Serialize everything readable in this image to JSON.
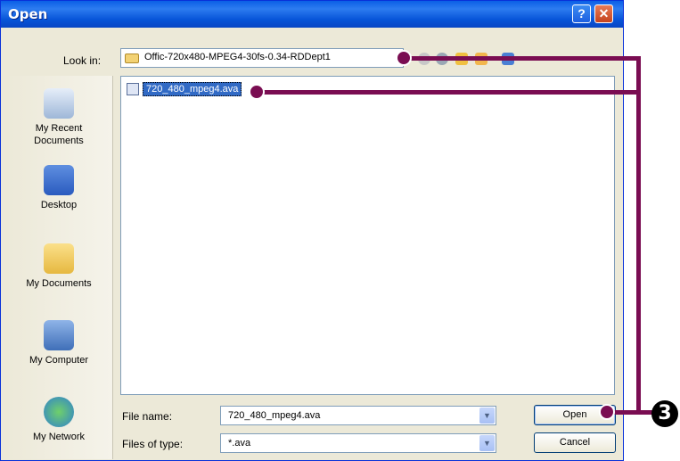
{
  "window": {
    "title": "Open",
    "help_glyph": "?",
    "close_glyph": "✕"
  },
  "lookin": {
    "label": "Look in:",
    "value": "Offic-720x480-MPEG4-30fs-0.34-RDDept1",
    "icon": "folder-icon"
  },
  "toolbar": {
    "icons": [
      "back-icon",
      "up-folder-icon",
      "new-folder-icon",
      "view-menu-icon"
    ]
  },
  "places": [
    {
      "label": "My Recent Documents",
      "icon": "recent-documents-icon"
    },
    {
      "label": "Desktop",
      "icon": "desktop-icon"
    },
    {
      "label": "My Documents",
      "icon": "my-documents-icon"
    },
    {
      "label": "My Computer",
      "icon": "my-computer-icon"
    },
    {
      "label": "My Network",
      "icon": "my-network-icon"
    }
  ],
  "files": [
    {
      "name": "720_480_mpeg4.ava",
      "selected": true,
      "icon": "video-file-icon"
    }
  ],
  "filename": {
    "label": "File name:",
    "value": "720_480_mpeg4.ava"
  },
  "filetype": {
    "label": "Files of type:",
    "value": "*.ava"
  },
  "buttons": {
    "open": "Open",
    "cancel": "Cancel"
  },
  "callout": {
    "step": "3",
    "color": "#7a0d52"
  },
  "colors": {
    "titlebar": "#0a5fe6",
    "selection": "#316ac5",
    "dialog_bg": "#ece9d8"
  }
}
